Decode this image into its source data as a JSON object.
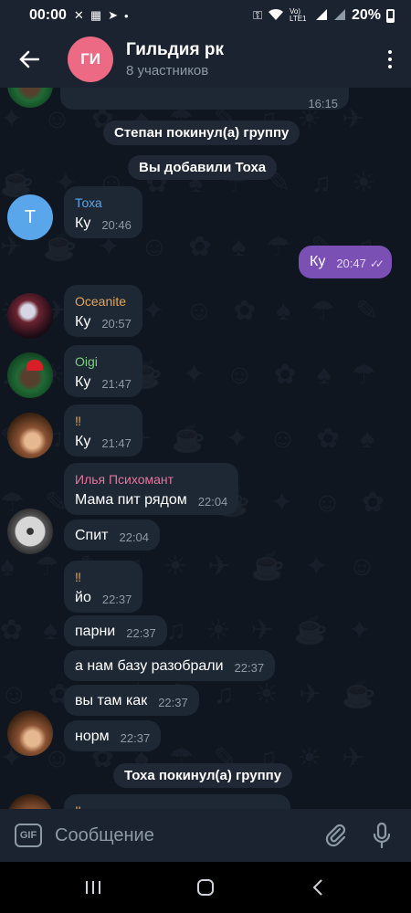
{
  "status_bar": {
    "time": "00:00",
    "battery": "20%",
    "battery_level": 0.2,
    "network_label": "Vo) LTE1"
  },
  "header": {
    "back_icon": "arrow-left-icon",
    "avatar_initials": "ГИ",
    "title": "Гильдия рк",
    "subtitle": "8 участников"
  },
  "messages": {
    "partial_time": "16:15",
    "service_1": "Степан покинул(а) группу",
    "service_2": "Вы добавили Тоха",
    "toha": {
      "avatar": "Т",
      "sender": "Тоха",
      "sender_color": "#5aa6ea",
      "text": "Ку",
      "time": "20:46"
    },
    "outgoing": {
      "text": "Ку",
      "time": "20:47",
      "status": "read"
    },
    "oceanite": {
      "sender": "Oceanite",
      "sender_color": "#e3a557",
      "text": "Ку",
      "time": "20:57"
    },
    "oigi": {
      "sender": "Oigi",
      "sender_color": "#7bd07c",
      "text": "Ку",
      "time": "21:47"
    },
    "excl_1": {
      "sender": "‼",
      "sender_color": "#e3a557",
      "text": "Ку",
      "time": "21:47"
    },
    "ilya_1": {
      "sender": "Илья Психомант",
      "sender_color": "#e3759b",
      "text": "Мама пит рядом",
      "time": "22:04"
    },
    "ilya_2": {
      "text": "Спит",
      "time": "22:04"
    },
    "excl_2": {
      "sender": "‼",
      "sender_color": "#e3a557",
      "text": "йо",
      "time": "22:37"
    },
    "excl_3": {
      "text": "парни",
      "time": "22:37"
    },
    "excl_4": {
      "text": "а нам базу разобрали",
      "time": "22:37"
    },
    "excl_5": {
      "text": "вы там как",
      "time": "22:37"
    },
    "excl_6": {
      "text": "норм",
      "time": "22:37"
    },
    "service_3": "Тоха покинул(а) группу",
    "partial_sender": "‼"
  },
  "input": {
    "placeholder": "Сообщение",
    "gif_label": "GIF"
  },
  "colors": {
    "header_bg": "#1b2331",
    "chat_bg": "#0f1620",
    "bubble_in": "#1e2835",
    "bubble_out": "#7a50b4",
    "avatar_group": "#ec6a84"
  }
}
